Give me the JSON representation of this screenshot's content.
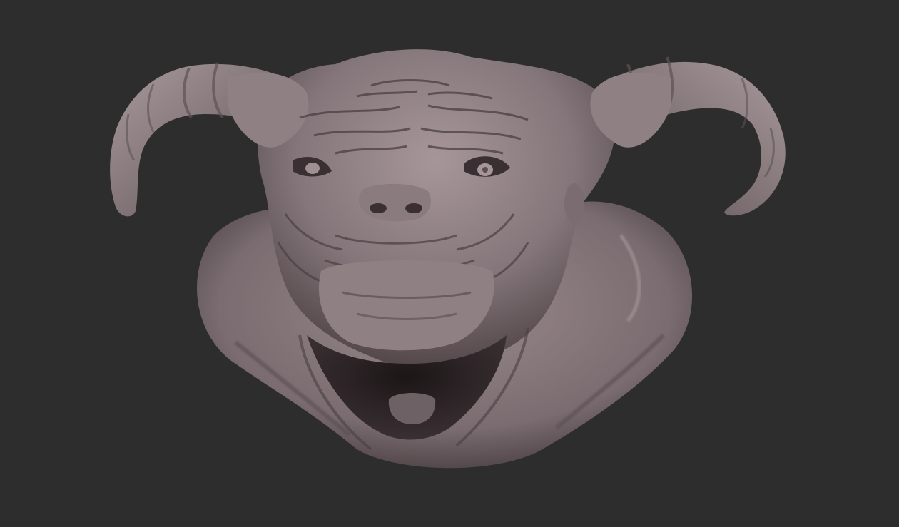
{
  "canvas": {
    "background": "#2d2d2d",
    "material_color": "#8a7b7e",
    "material_highlight": "#b3a3a6",
    "material_shadow": "#3f3436"
  },
  "subject": {
    "icon": "demon-head-sculpt-icon"
  }
}
